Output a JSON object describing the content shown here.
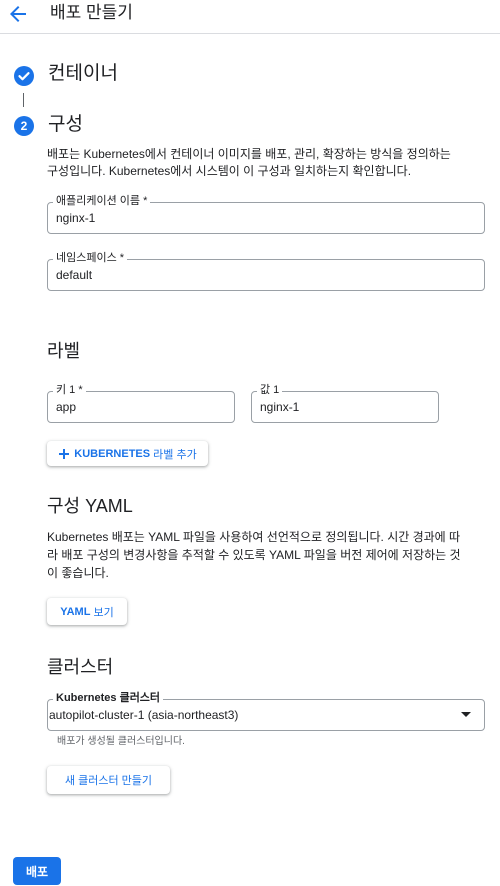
{
  "header": {
    "title": "배포 만들기"
  },
  "steps": [
    {
      "label": "컨테이너",
      "state": "completed"
    },
    {
      "number": "2",
      "label": "구성",
      "state": "active"
    }
  ],
  "config": {
    "description_line1": "배포는 Kubernetes에서 컨테이너 이미지를 배포, 관리, 확장하는 방식을 정의하는",
    "description_line2": "구성입니다. Kubernetes에서 시스템이 이 구성과 일치하는지 확인합니다.",
    "app_name_label": "애플리케이션 이름 *",
    "app_name_value": "nginx-1",
    "namespace_label": "네임스페이스 *",
    "namespace_value": "default"
  },
  "labels_section": {
    "title": "라벨",
    "key_label": "키 1 *",
    "key_value": "app",
    "value_label": "값 1",
    "value_value": "nginx-1",
    "add_button_bold": "KUBERNETES",
    "add_button_rest": " 라벨 추가",
    "add_icon": "plus-icon"
  },
  "yaml_section": {
    "title": "구성 YAML",
    "description_line1": "Kubernetes 배포는 YAML 파일을 사용하여 선언적으로 정의됩니다. 시간 경과에 따",
    "description_line2": "라 배포 구성의 변경사항을 추적할 수 있도록 YAML 파일을 버전 제어에 저장하는 것",
    "description_line3": "이 좋습니다.",
    "view_button_bold": "YAML",
    "view_button_rest": " 보기"
  },
  "cluster_section": {
    "title": "클러스터",
    "select_label": "Kubernetes 클러스터",
    "select_value": "autopilot-cluster-1 (asia-northeast3)",
    "helper": "배포가 생성될 클러스터입니다.",
    "create_button": "새 클러스터 만들기"
  },
  "footer": {
    "deploy_button": "배포"
  },
  "colors": {
    "accent": "#1a73e8",
    "border": "#9aa0a6",
    "text": "#202124"
  }
}
